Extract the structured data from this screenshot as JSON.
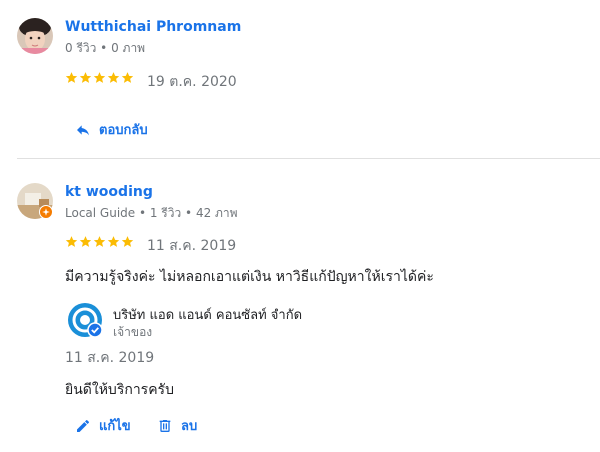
{
  "reviews": [
    {
      "author": "Wutthichai Phromnam",
      "meta": "0 รีวิว • 0 ภาพ",
      "rating": 5,
      "date": "19 ต.ค. 2020",
      "reply_label": "ตอบกลับ"
    },
    {
      "author": "kt wooding",
      "meta": "Local Guide • 1 รีวิว • 42 ภาพ",
      "rating": 5,
      "date": "11 ส.ค. 2019",
      "text": "มีความรู้จริงค่ะ ไม่หลอกเอาแต่เงิน หาวิธีแก้ปัญหาให้เราได้ค่ะ",
      "owner_response": {
        "owner_name": "บริษัท แอด แอนด์ คอนซัลท์ จำกัด",
        "owner_label": "เจ้าของ",
        "date": "11 ส.ค. 2019",
        "text": "ยินดีให้บริการครับ"
      },
      "edit_label": "แก้ไข",
      "delete_label": "ลบ"
    }
  ],
  "colors": {
    "star": "#fbbc04",
    "link": "#1a73e8",
    "guide_badge": "#f57c00",
    "owner_logo": "#1a8fd8"
  }
}
